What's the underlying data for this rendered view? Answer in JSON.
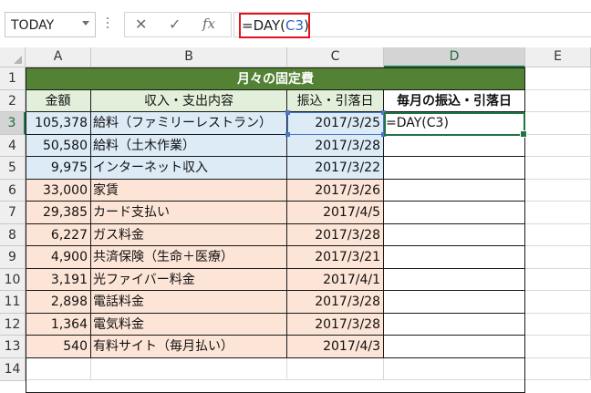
{
  "formula_bar": {
    "name_box": "TODAY",
    "cancel_icon": "✕",
    "enter_icon": "✓",
    "fx_icon": "fx",
    "formula_prefix": "=DAY(",
    "formula_ref": "C3",
    "formula_suffix": ")"
  },
  "columns": [
    "A",
    "B",
    "C",
    "D",
    "E"
  ],
  "rows": [
    "1",
    "2",
    "3",
    "4",
    "5",
    "6",
    "7",
    "8",
    "9",
    "10",
    "11",
    "12",
    "13",
    "14"
  ],
  "sheet": {
    "title": "月々の固定費",
    "headers": {
      "amount": "金額",
      "item": "収入・支出内容",
      "date": "振込・引落日",
      "day": "毎月の振込・引落日"
    },
    "active_cell_input": "=DAY(C3)",
    "records": [
      {
        "amount": "105,378",
        "item": "給料（ファミリーレストラン）",
        "date": "2017/3/25",
        "type": "income"
      },
      {
        "amount": "50,580",
        "item": "給料（土木作業）",
        "date": "2017/3/28",
        "type": "income"
      },
      {
        "amount": "9,975",
        "item": "インターネット収入",
        "date": "2017/3/22",
        "type": "income"
      },
      {
        "amount": "33,000",
        "item": "家賃",
        "date": "2017/3/26",
        "type": "expense"
      },
      {
        "amount": "29,385",
        "item": "カード支払い",
        "date": "2017/4/5",
        "type": "expense"
      },
      {
        "amount": "6,227",
        "item": "ガス料金",
        "date": "2017/3/28",
        "type": "expense"
      },
      {
        "amount": "4,900",
        "item": "共済保険（生命＋医療）",
        "date": "2017/3/21",
        "type": "expense"
      },
      {
        "amount": "3,191",
        "item": "光ファイバー料金",
        "date": "2017/4/1",
        "type": "expense"
      },
      {
        "amount": "2,898",
        "item": "電話料金",
        "date": "2017/3/28",
        "type": "expense"
      },
      {
        "amount": "1,364",
        "item": "電気料金",
        "date": "2017/3/28",
        "type": "expense"
      },
      {
        "amount": "540",
        "item": "有料サイト（毎月払い）",
        "date": "2017/4/3",
        "type": "expense"
      }
    ]
  },
  "colors": {
    "title_bg": "#548235",
    "header_bg": "#e2efda",
    "income_bg": "#ddebf7",
    "expense_bg": "#fce4d6",
    "selection_green": "#217346",
    "ref_blue": "#2f64c2",
    "highlight_red": "#e0121b"
  }
}
